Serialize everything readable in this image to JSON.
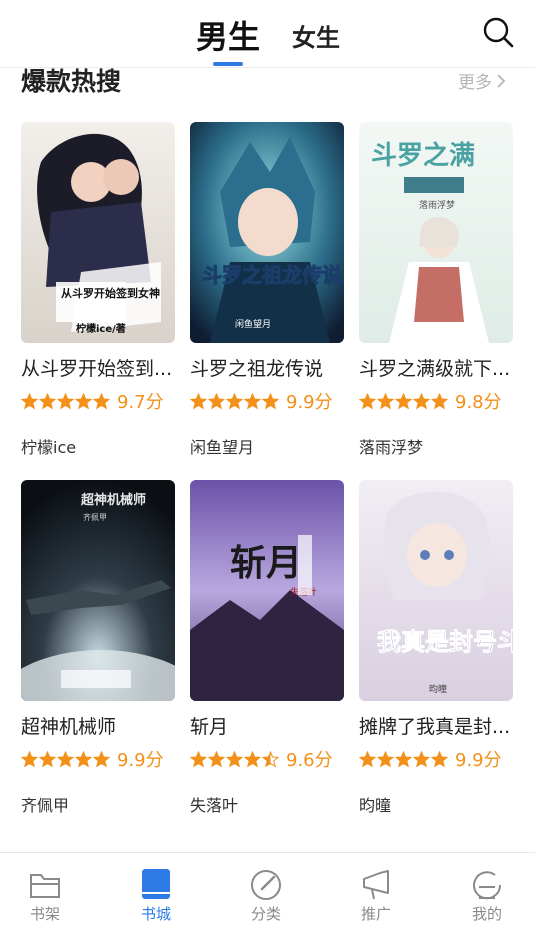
{
  "header": {
    "tabs": [
      {
        "label": "男生",
        "active": true
      },
      {
        "label": "女生",
        "active": false
      }
    ],
    "search_icon": "search-icon"
  },
  "section": {
    "title": "爆款热搜",
    "more_label": "更多"
  },
  "books": [
    {
      "title": "从斗罗开始签到...",
      "score": "9.7分",
      "stars": 5,
      "author": "柠檬ice",
      "cover_text": "从斗罗开始签到女神",
      "cover_sub": "柠檬ice/著"
    },
    {
      "title": "斗罗之祖龙传说",
      "score": "9.9分",
      "stars": 5,
      "author": "闲鱼望月",
      "cover_text": "斗罗之祖龙传说",
      "cover_sub": "闲鱼望月"
    },
    {
      "title": "斗罗之满级就下...",
      "score": "9.8分",
      "stars": 5,
      "author": "落雨浮梦",
      "cover_text": "斗罗之满",
      "cover_sub": "落雨浮梦"
    },
    {
      "title": "超神机械师",
      "score": "9.9分",
      "stars": 5,
      "author": "齐佩甲",
      "cover_text": "超神机械师",
      "cover_sub": "齐佩甲"
    },
    {
      "title": "斩月",
      "score": "9.6分",
      "stars": 4.5,
      "author": "失落叶",
      "cover_text": "斩月",
      "cover_sub": "失落叶"
    },
    {
      "title": "摊牌了我真是封...",
      "score": "9.9分",
      "stars": 5,
      "author": "昀曈",
      "cover_text": "我真是封号斗罗",
      "cover_sub": "昀曈"
    }
  ],
  "bottom_nav": [
    {
      "label": "书架",
      "icon": "bookshelf-icon",
      "active": false
    },
    {
      "label": "书城",
      "icon": "bookstore-icon",
      "active": true
    },
    {
      "label": "分类",
      "icon": "category-icon",
      "active": false
    },
    {
      "label": "推广",
      "icon": "promotion-icon",
      "active": false
    },
    {
      "label": "我的",
      "icon": "profile-icon",
      "active": false
    }
  ],
  "colors": {
    "accent": "#2f7be6",
    "star": "#f39019",
    "muted": "#8a8a8a"
  }
}
